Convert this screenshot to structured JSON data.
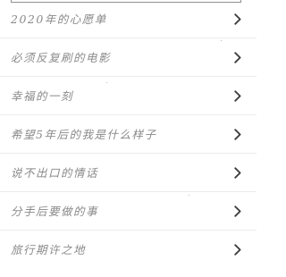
{
  "list": {
    "items": [
      {
        "label": "2020年的心愿单",
        "icon": "chevron-right-icon"
      },
      {
        "label": "必须反复刷的电影",
        "icon": "chevron-right-icon"
      },
      {
        "label": "幸福的一刻",
        "icon": "chevron-right-icon"
      },
      {
        "label": "希望5年后的我是什么样子",
        "icon": "chevron-right-icon"
      },
      {
        "label": "说不出口的情话",
        "icon": "chevron-right-icon"
      },
      {
        "label": "分手后要做的事",
        "icon": "chevron-right-icon"
      },
      {
        "label": "旅行期许之地",
        "icon": "chevron-right-icon"
      }
    ]
  },
  "colors": {
    "text": "#8a8a8a",
    "chevron": "#3a3a3a",
    "divider": "#ececec",
    "background": "#ffffff"
  }
}
